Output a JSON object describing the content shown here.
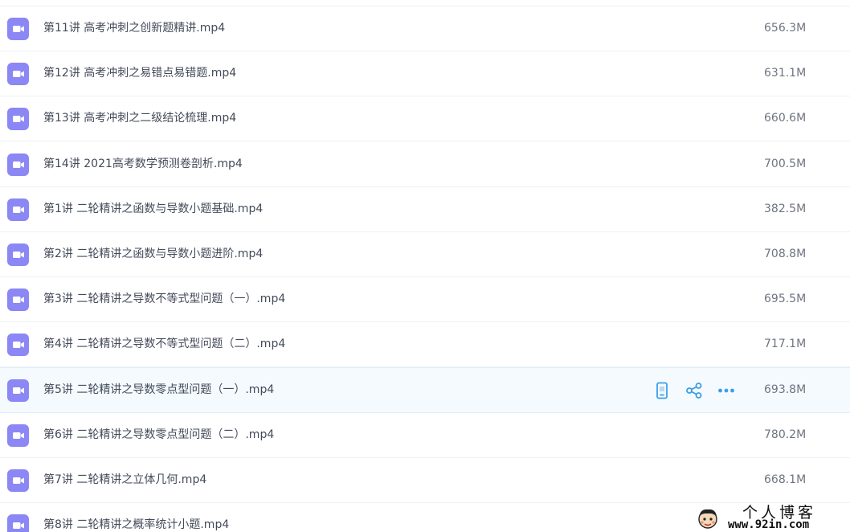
{
  "files": [
    {
      "name": "第11讲 高考冲刺之创新题精讲.mp4",
      "size": "656.3M"
    },
    {
      "name": "第12讲 高考冲刺之易错点易错题.mp4",
      "size": "631.1M"
    },
    {
      "name": "第13讲 高考冲刺之二级结论梳理.mp4",
      "size": "660.6M"
    },
    {
      "name": "第14讲 2021高考数学预测卷剖析.mp4",
      "size": "700.5M"
    },
    {
      "name": "第1讲 二轮精讲之函数与导数小题基础.mp4",
      "size": "382.5M"
    },
    {
      "name": "第2讲 二轮精讲之函数与导数小题进阶.mp4",
      "size": "708.8M"
    },
    {
      "name": "第3讲 二轮精讲之导数不等式型问题（一）.mp4",
      "size": "695.5M"
    },
    {
      "name": "第4讲 二轮精讲之导数不等式型问题（二）.mp4",
      "size": "717.1M"
    },
    {
      "name": "第5讲 二轮精讲之导数零点型问题（一）.mp4",
      "size": "693.8M",
      "hovered": true
    },
    {
      "name": "第6讲 二轮精讲之导数零点型问题（二）.mp4",
      "size": "780.2M"
    },
    {
      "name": "第7讲 二轮精讲之立体几何.mp4",
      "size": "668.1M"
    },
    {
      "name": "第8讲 二轮精讲之概率统计小题.mp4",
      "size": ""
    }
  ],
  "row_actions": {
    "icons": [
      "phone-icon",
      "share-icon",
      "more-icon"
    ]
  },
  "colors": {
    "accent": "#3b9ee8",
    "video_icon": "#8b87f5",
    "hover_row": "#f4fafe"
  },
  "watermark": {
    "title": "个人博客",
    "url": "www.92in.com"
  }
}
